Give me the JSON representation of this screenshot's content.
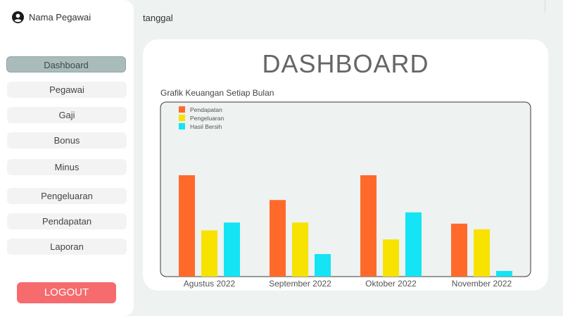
{
  "user": {
    "name": "Nama Pegawai",
    "icon": "user-circle-icon"
  },
  "sidebar": {
    "items": [
      {
        "label": "Dashboard",
        "active": true
      },
      {
        "label": "Pegawai",
        "active": false
      },
      {
        "label": "Gaji",
        "active": false
      },
      {
        "label": "Bonus",
        "active": false
      },
      {
        "label": "Minus",
        "active": false
      },
      {
        "label": "Pengeluaran",
        "active": false
      },
      {
        "label": "Pendapatan",
        "active": false
      },
      {
        "label": "Laporan",
        "active": false
      }
    ],
    "logout_label": "LOGOUT"
  },
  "topbar": {
    "date_label": "tanggal"
  },
  "main": {
    "title": "DASHBOARD",
    "chart_title": "Grafik Keuangan Setiap Bulan"
  },
  "colors": {
    "accent_active": "#a9bcbb",
    "logout": "#f56b6e",
    "pendapatan": "#ff6a2b",
    "pengeluaran": "#f7e200",
    "hasil_bersih": "#14e4f4"
  },
  "chart_data": {
    "type": "bar",
    "title": "Grafik Keuangan Setiap Bulan",
    "categories": [
      "Agustus 2022",
      "September 2022",
      "Oktober 2022",
      "November 2022"
    ],
    "series": [
      {
        "name": "Pendapatan",
        "color": "#ff6a2b",
        "values": [
          90,
          68,
          90,
          47
        ]
      },
      {
        "name": "Pengeluaran",
        "color": "#f7e200",
        "values": [
          41,
          48,
          33,
          42
        ]
      },
      {
        "name": "Hasil Bersih",
        "color": "#14e4f4",
        "values": [
          48,
          20,
          57,
          5
        ]
      }
    ],
    "ylim": [
      0,
      100
    ],
    "grid": false,
    "legend": "top-left"
  }
}
